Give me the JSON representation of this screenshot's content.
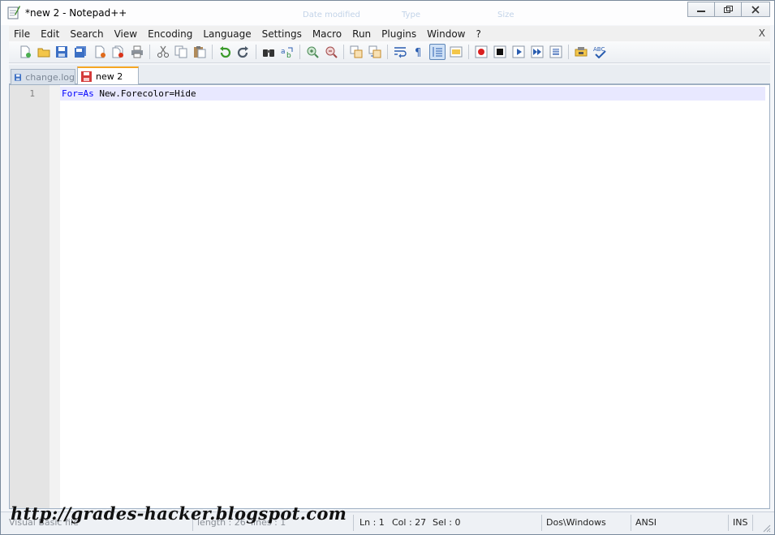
{
  "window": {
    "title": "*new  2 - Notepad++",
    "background_ghost_text": [
      "Date modified",
      "Type",
      "Size"
    ]
  },
  "menu": {
    "items": [
      "File",
      "Edit",
      "Search",
      "View",
      "Encoding",
      "Language",
      "Settings",
      "Macro",
      "Run",
      "Plugins",
      "Window",
      "?"
    ],
    "close_label": "X"
  },
  "toolbar": {
    "icons": [
      "new-file-icon",
      "open-file-icon",
      "save-icon",
      "save-all-icon",
      "close-file-icon",
      "close-all-icon",
      "print-icon",
      "cut-icon",
      "copy-icon",
      "paste-icon",
      "undo-icon",
      "redo-icon",
      "find-icon",
      "replace-icon",
      "zoom-in-icon",
      "zoom-out-icon",
      "sync-vertical-icon",
      "sync-horizontal-icon",
      "word-wrap-icon",
      "show-all-chars-icon",
      "indent-guide-icon",
      "user-defined-dialog-icon",
      "record-macro-icon",
      "stop-record-icon",
      "play-macro-icon",
      "run-macro-multiple-icon",
      "save-macro-icon",
      "plugin-icon",
      "spell-check-icon"
    ],
    "active_icon": "indent-guide-icon"
  },
  "tabs": [
    {
      "label": "change.log",
      "active": false
    },
    {
      "label": "new  2",
      "active": true
    }
  ],
  "editor": {
    "lines": [
      {
        "number": "1",
        "keyword": "For=As",
        "rest": " New.Forecolor=Hide"
      }
    ]
  },
  "status": {
    "file_type": "Visual Basic file",
    "length": "length : 26",
    "lines": "lines : 1",
    "ln": "Ln : 1",
    "col": "Col : 27",
    "sel": "Sel : 0",
    "eol": "Dos\\Windows",
    "encoding": "ANSI",
    "mode": "INS"
  },
  "watermark": "http://grades-hacker.blogspot.com",
  "colors": {
    "keyword": "#0000ff",
    "current_line": "#e8e8ff",
    "active_tab_accent": "#f5a623"
  }
}
